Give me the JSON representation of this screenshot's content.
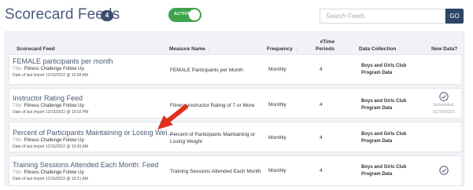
{
  "header": {
    "title": "Scorecard Feeds",
    "count": "4",
    "toggle_label": "ACTIVE",
    "toggle_on": true,
    "search_placeholder": "Search Feeds",
    "go_label": "GO"
  },
  "table": {
    "columns": {
      "feed": "Scorecard Feed",
      "measure": "Measure Name",
      "frequency": "Frequency",
      "periods_line1": "#Time",
      "periods_line2": "Periods",
      "collection": "Data Collection",
      "newdata": "New Data?"
    },
    "title_label": "Title:",
    "rows": [
      {
        "feed": "FEMALE participants per month",
        "title": "Fitness Challenge Follow Up",
        "date": "Date of last import 12/16/2022 @ 10:58 AM",
        "measure": "FEMALE Participants per Month",
        "frequency": "Monthly",
        "periods": "4",
        "collection_line1": "Boys and Girls Club",
        "collection_line2": "Program Data",
        "new_data": ""
      },
      {
        "feed": "Instructor Rating Feed",
        "title": "Fitness Challenge Follow Up",
        "date": "Date of last import 12/15/2022 @ 10:03 PM",
        "measure": "Fitness Instructor Rating of 7 or More",
        "frequency": "Monthly",
        "periods": "4",
        "collection_line1": "Boys and Girls Club",
        "collection_line2": "Program Data",
        "new_data": "check",
        "scheduled_label": "Scheduled:",
        "scheduled_date": "01/10/2023"
      },
      {
        "feed": "Percent of Participants Maintaining or Losing Wei...",
        "title": "Fitness Challenge Follow Up",
        "date": "Date of last import 12/16/2022 @ 10:20 AM",
        "measure_line1": "Percent of Participants Maintaining or",
        "measure_line2": "Losing Weight",
        "frequency": "Monthly",
        "periods": "4",
        "collection_line1": "Boys and Girls Club",
        "collection_line2": "Program Data",
        "new_data": ""
      },
      {
        "feed": "Training Sessions Attended Each Month: Feed",
        "title": "Fitness Challenge Follow Up",
        "date": "Date of last import 12/16/2022 @ 10:21 AM",
        "measure": "Training Sessions Attended Each Month",
        "frequency": "Monthly",
        "periods": "4",
        "collection_line1": "Boys and Girls Club",
        "collection_line2": "Program Data",
        "new_data": "check"
      }
    ]
  },
  "colors": {
    "brand_navy": "#2f4568",
    "active_green": "#3fa34d",
    "annotation_arrow": "#e0301e"
  },
  "icons": {
    "check": "check-circle-icon",
    "sort": "sort-icon",
    "annotation": "red-arrow-annotation"
  }
}
